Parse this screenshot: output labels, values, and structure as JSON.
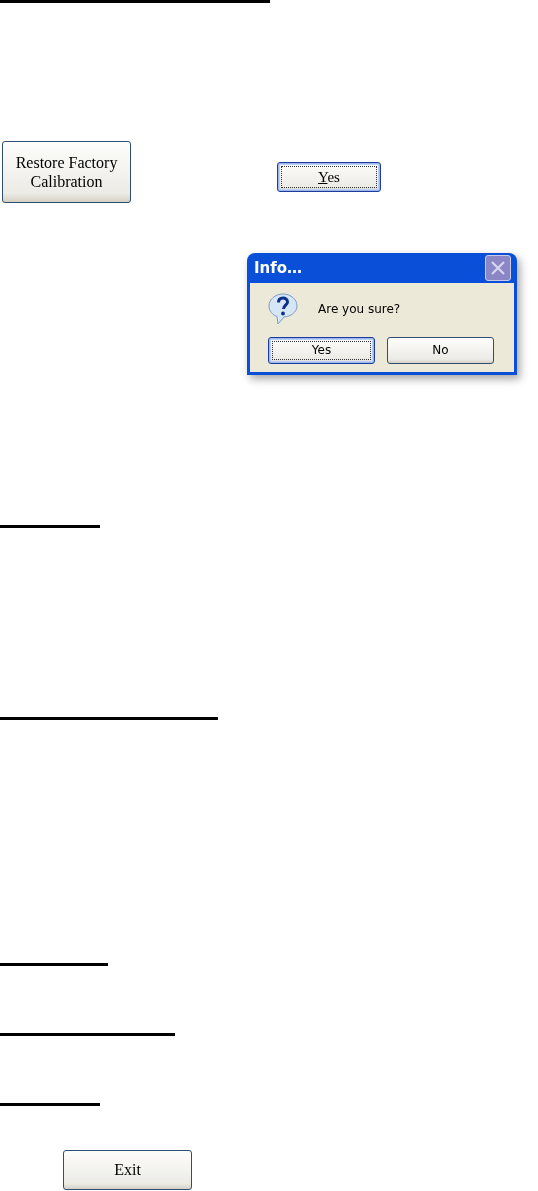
{
  "calibration_button": {
    "label": "Restore Factory Calibration",
    "focused": false
  },
  "confirm_button": {
    "label": "Yes",
    "focused": true
  },
  "dialog": {
    "title": "Info…",
    "message": "Are you sure?",
    "buttons": [
      {
        "label": "Yes",
        "focused": true
      },
      {
        "label": "No",
        "focused": false
      }
    ]
  },
  "exit_button": {
    "label": "Exit",
    "focused": false
  }
}
